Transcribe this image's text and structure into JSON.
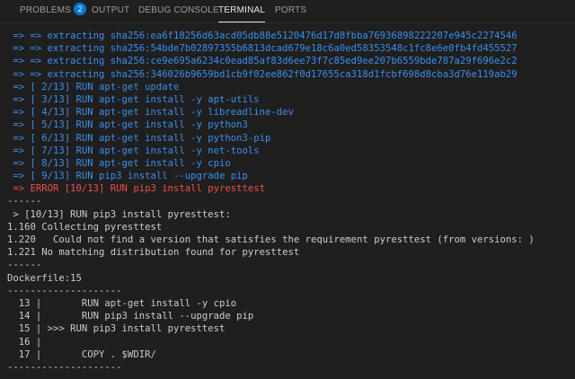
{
  "tabs": [
    {
      "label": "PROBLEMS",
      "badge": "2"
    },
    {
      "label": "OUTPUT"
    },
    {
      "label": "DEBUG CONSOLE"
    },
    {
      "label": "TERMINAL",
      "active": true
    },
    {
      "label": "PORTS"
    }
  ],
  "colors": {
    "background": "#1f1f1f",
    "build_step": "#3b8eea",
    "error": "#f14c4c",
    "text": "#cccccc",
    "badge": "#0078d4"
  },
  "terminal": {
    "lines": [
      {
        "text": " => => extracting sha256:ea6f18256d63acd05db88e5120476d17d8fbba76936898222207e945c2274546",
        "style": "blue"
      },
      {
        "text": " => => extracting sha256:54bde7b02897355b6813dcad679e18c6a0ed58353548c1fc8e6e0fb4fd455527",
        "style": "blue"
      },
      {
        "text": " => => extracting sha256:ce9e695a6234c0ead85af83d6ee73f7c85ed9ee207b6559bde787a29f696e2c2",
        "style": "blue"
      },
      {
        "text": " => => extracting sha256:346026b9659bd1cb9f02ee862f0d17655ca318d1fcbf698d8cba3d76e119ab29",
        "style": "blue"
      },
      {
        "text": " => [ 2/13] RUN apt-get update",
        "style": "blue"
      },
      {
        "text": " => [ 3/13] RUN apt-get install -y apt-utils",
        "style": "blue"
      },
      {
        "text": " => [ 4/13] RUN apt-get install -y libreadline-dev",
        "style": "blue"
      },
      {
        "text": " => [ 5/13] RUN apt-get install -y python3",
        "style": "blue"
      },
      {
        "text": " => [ 6/13] RUN apt-get install -y python3-pip",
        "style": "blue"
      },
      {
        "text": " => [ 7/13] RUN apt-get install -y net-tools",
        "style": "blue"
      },
      {
        "text": " => [ 8/13] RUN apt-get install -y cpio",
        "style": "blue"
      },
      {
        "text": " => [ 9/13] RUN pip3 install --upgrade pip",
        "style": "blue"
      },
      {
        "text": " => ERROR [10/13] RUN pip3 install pyresttest",
        "style": "red"
      },
      {
        "text": "------",
        "style": "plain"
      },
      {
        "text": " > [10/13] RUN pip3 install pyresttest:",
        "style": "plain"
      },
      {
        "text": "1.160 Collecting pyresttest",
        "style": "plain"
      },
      {
        "text": "1.220   Could not find a version that satisfies the requirement pyresttest (from versions: )",
        "style": "plain"
      },
      {
        "text": "1.221 No matching distribution found for pyresttest",
        "style": "plain"
      },
      {
        "text": "------",
        "style": "plain"
      },
      {
        "text": "Dockerfile:15",
        "style": "plain"
      },
      {
        "text": "--------------------",
        "style": "plain"
      },
      {
        "text": "  13 |       RUN apt-get install -y cpio",
        "style": "plain"
      },
      {
        "text": "  14 |       RUN pip3 install --upgrade pip",
        "style": "plain"
      },
      {
        "text": "  15 | >>> RUN pip3 install pyresttest",
        "style": "plain"
      },
      {
        "text": "  16 |",
        "style": "plain"
      },
      {
        "text": "  17 |       COPY . $WDIR/",
        "style": "plain"
      },
      {
        "text": "--------------------",
        "style": "plain"
      }
    ]
  }
}
